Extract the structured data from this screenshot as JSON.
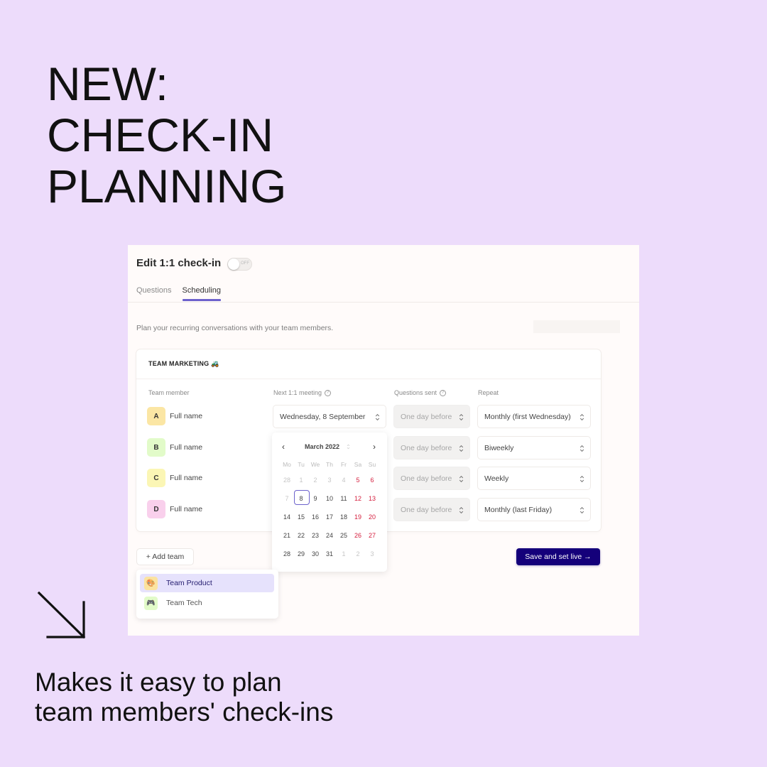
{
  "headline": [
    "NEW:",
    "CHECK-IN",
    "PLANNING"
  ],
  "tagline": [
    "Makes it easy to plan",
    "team members' check-ins"
  ],
  "colors": {
    "background": "#eddcfb",
    "accent": "#6d62cc",
    "primary_button": "#14007a",
    "weekend": "#d51f3e"
  },
  "app": {
    "title": "Edit 1:1 check-in",
    "back_icon": "chevron-left-icon",
    "toggle": {
      "label": "OFF",
      "on": false
    },
    "tabs": [
      {
        "label": "Questions",
        "active": false
      },
      {
        "label": "Scheduling",
        "active": true
      }
    ],
    "intro": "Plan your recurring conversations with your team members.",
    "team": {
      "title": "TEAM MARKETING 🚜",
      "columns": {
        "member": "Team member",
        "next_meeting": "Next 1:1 meeting",
        "questions_sent": "Questions sent",
        "repeat": "Repeat"
      },
      "rows": [
        {
          "initial": "A",
          "name": "Full name",
          "avatar_color": "#fbe6a4",
          "next_meeting": "Wednesday, 8 September",
          "questions_sent": "One day before",
          "repeat": "Monthly (first Wednesday)"
        },
        {
          "initial": "B",
          "name": "Full name",
          "avatar_color": "#e2fbc9",
          "next_meeting": "",
          "questions_sent": "One day before",
          "repeat": "Biweekly"
        },
        {
          "initial": "C",
          "name": "Full name",
          "avatar_color": "#fbf6b5",
          "next_meeting": "",
          "questions_sent": "One day before",
          "repeat": "Weekly"
        },
        {
          "initial": "D",
          "name": "Full name",
          "avatar_color": "#f9d0ec",
          "next_meeting": "",
          "questions_sent": "One day before",
          "repeat": "Monthly (last Friday)"
        }
      ]
    },
    "calendar": {
      "month_label": "March 2022",
      "prev_icon": "chevron-left-icon",
      "next_icon": "chevron-right-icon",
      "weekdays": [
        "Mo",
        "Tu",
        "We",
        "Th",
        "Fr",
        "Sa",
        "Su"
      ],
      "weeks": [
        [
          {
            "d": "28",
            "m": true
          },
          {
            "d": "1",
            "m": true
          },
          {
            "d": "2",
            "m": true
          },
          {
            "d": "3",
            "m": true
          },
          {
            "d": "4",
            "m": true
          },
          {
            "d": "5",
            "w": true
          },
          {
            "d": "6",
            "w": true
          }
        ],
        [
          {
            "d": "7",
            "m": true
          },
          {
            "d": "8",
            "s": true
          },
          {
            "d": "9"
          },
          {
            "d": "10"
          },
          {
            "d": "11"
          },
          {
            "d": "12",
            "w": true
          },
          {
            "d": "13",
            "w": true
          }
        ],
        [
          {
            "d": "14"
          },
          {
            "d": "15"
          },
          {
            "d": "16"
          },
          {
            "d": "17"
          },
          {
            "d": "18"
          },
          {
            "d": "19",
            "w": true
          },
          {
            "d": "20",
            "w": true
          }
        ],
        [
          {
            "d": "21"
          },
          {
            "d": "22"
          },
          {
            "d": "23"
          },
          {
            "d": "24"
          },
          {
            "d": "25"
          },
          {
            "d": "26",
            "w": true
          },
          {
            "d": "27",
            "w": true
          }
        ],
        [
          {
            "d": "28"
          },
          {
            "d": "29"
          },
          {
            "d": "30"
          },
          {
            "d": "31"
          },
          {
            "d": "1",
            "m": true
          },
          {
            "d": "2",
            "m": true
          },
          {
            "d": "3",
            "m": true
          }
        ]
      ],
      "selected_day": "8"
    },
    "add_team_label": "+ Add team",
    "team_menu": [
      {
        "label": "Team Product",
        "icon": "palette-icon",
        "glyph": "🎨",
        "icon_bg": "#fbe3a0",
        "active": true
      },
      {
        "label": "Team Tech",
        "icon": "gamepad-icon",
        "glyph": "🎮",
        "icon_bg": "#e2fbc9",
        "active": false
      }
    ],
    "save_label": "Save and set live →"
  }
}
